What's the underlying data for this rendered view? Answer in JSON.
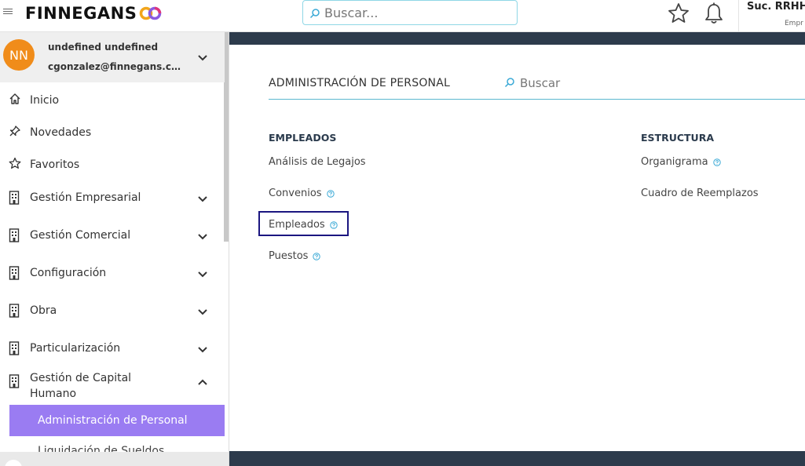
{
  "header": {
    "logo_text": "FINNEGANS",
    "search_placeholder": "Buscar...",
    "branch": "Suc. RRHH",
    "company": "Empr"
  },
  "user": {
    "initials": "NN",
    "name": "undefined undefined",
    "email": "cgonzalez@finnegans.co..."
  },
  "sidebar": {
    "items": [
      {
        "label": "Inicio",
        "icon": "home-icon"
      },
      {
        "label": "Novedades",
        "icon": "pin-icon"
      },
      {
        "label": "Favoritos",
        "icon": "star-icon"
      },
      {
        "label": "Gestión Empresarial",
        "icon": "building-icon",
        "expanded": false
      },
      {
        "label": "Gestión Comercial",
        "icon": "building-icon",
        "expanded": false
      },
      {
        "label": "Configuración",
        "icon": "building-icon",
        "expanded": false
      },
      {
        "label": "Obra",
        "icon": "building-icon",
        "expanded": false
      },
      {
        "label": "Particularización",
        "icon": "building-icon",
        "expanded": false
      },
      {
        "label_line1": "Gestión de Capital",
        "label_line2": "Humano",
        "icon": "building-icon",
        "expanded": true
      }
    ],
    "active_sub": "Administración de Personal",
    "next_sub": "Liquidación de Sueldos"
  },
  "main": {
    "title": "ADMINISTRACIÓN DE PERSONAL",
    "search_placeholder": "Buscar",
    "columns": [
      {
        "heading": "EMPLEADOS",
        "links": [
          {
            "label": "Análisis de Legajos",
            "help": false
          },
          {
            "label": "Convenios",
            "help": true
          },
          {
            "label": "Empleados",
            "help": true,
            "highlighted": true
          },
          {
            "label": "Puestos",
            "help": true
          }
        ]
      },
      {
        "heading": "ESTRUCTURA",
        "links": [
          {
            "label": "Organigrama",
            "help": true
          },
          {
            "label": "Cuadro de Reemplazos",
            "help": false
          }
        ]
      }
    ]
  },
  "colors": {
    "accent_purple": "#9a7cf2",
    "avatar_orange": "#f08c1a",
    "dark_band": "#2d3b4c",
    "highlight_border": "#1b1680",
    "help_icon": "#3aa9d6"
  }
}
